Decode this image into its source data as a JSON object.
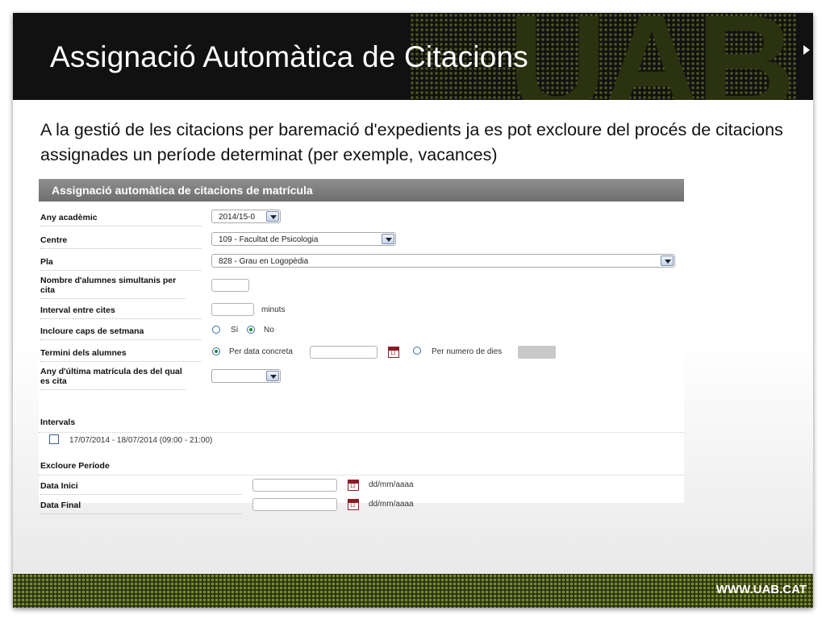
{
  "slide": {
    "title": "Assignació Automàtica de Citacions",
    "intro": "A la gestió de les citacions per baremació d'expedients ja es pot excloure del procés de citacions assignades un període determinat (per exemple, vacances)",
    "footer_url": "WWW.UAB.CAT",
    "watermark": "UAB"
  },
  "form": {
    "header": "Assignació automàtica de citacions de matrícula",
    "any_academic": {
      "label": "Any acadèmic",
      "value": "2014/15-0"
    },
    "centre": {
      "label": "Centre",
      "value": "109 - Facultat de Psicologia"
    },
    "pla": {
      "label": "Pla",
      "value": "828 - Grau en Logopèdia"
    },
    "nombre_alumnes": {
      "label": "Nombre d'alumnes simultanis per cita",
      "value": ""
    },
    "interval": {
      "label": "Interval entre cites",
      "value": "",
      "unit": "minuts"
    },
    "caps_setmana": {
      "label": "Incloure caps de setmana",
      "opt_si": "Sí",
      "opt_no": "No",
      "selected": "No"
    },
    "termini": {
      "label": "Termini dels alumnes",
      "opt_data": "Per data concreta",
      "opt_dies": "Per numero de dies",
      "selected": "Per data concreta",
      "data_value": ""
    },
    "any_ultima": {
      "label": "Any d'última matrícula des del qual es cita",
      "value": ""
    },
    "intervals": {
      "label": "Intervals",
      "items": [
        {
          "text": "17/07/2014 - 18/07/2014 (09:00 - 21:00)",
          "checked": false
        }
      ]
    },
    "excloure": {
      "label": "Excloure Període",
      "data_inici": {
        "label": "Data Inici",
        "value": "",
        "format": "dd/mm/aaaa"
      },
      "data_final": {
        "label": "Data Final",
        "value": "",
        "format": "dd/mm/aaaa"
      }
    }
  },
  "colors": {
    "header_bg": "#111111",
    "accent_green": "#7e8f2f",
    "calendar_red": "#8b1d24",
    "form_header": "#7a7a7a"
  }
}
